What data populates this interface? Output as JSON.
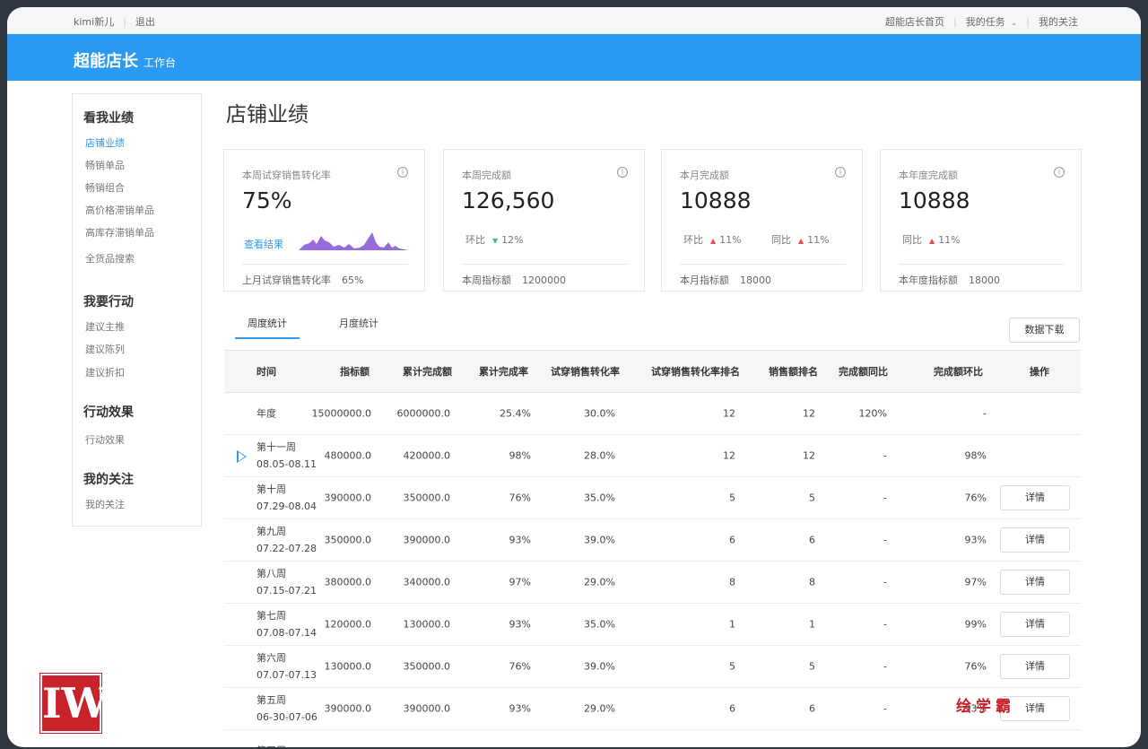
{
  "topbar": {
    "user": "kimi新儿",
    "logout": "退出",
    "home": "超能店长首页",
    "tasks": "我的任务",
    "follow": "我的关注"
  },
  "header": {
    "brand": "超能店长",
    "sub": "工作台"
  },
  "sidebar": {
    "groups": [
      {
        "title": "看我业绩",
        "items": [
          "店铺业绩",
          "畅销单品",
          "畅销组合",
          "高价格滞销单品",
          "高库存滞销单品",
          "全货品搜索"
        ]
      },
      {
        "title": "我要行动",
        "items": [
          "建议主推",
          "建议陈列",
          "建议折扣"
        ]
      },
      {
        "title": "行动效果",
        "items": [
          "行动效果"
        ]
      },
      {
        "title": "我的关注",
        "items": [
          "我的关注"
        ]
      }
    ]
  },
  "page_title": "店铺业绩",
  "cards": [
    {
      "label": "本周试穿销售转化率",
      "value": "75%",
      "link": "查看结果",
      "foot_label": "上月试穿销售转化率",
      "foot_value": "65%"
    },
    {
      "label": "本周完成额",
      "value": "126,560",
      "cmp1_label": "环比",
      "cmp1_value": "12%",
      "cmp1_dir": "down",
      "foot_label": "本周指标额",
      "foot_value": "1200000"
    },
    {
      "label": "本月完成额",
      "value": "10888",
      "cmp1_label": "环比",
      "cmp1_value": "11%",
      "cmp2_label": "同比",
      "cmp2_value": "11%",
      "foot_label": "本月指标额",
      "foot_value": "18000"
    },
    {
      "label": "本年度完成额",
      "value": "10888",
      "cmp1_label": "同比",
      "cmp1_value": "11%",
      "foot_label": "本年度指标额",
      "foot_value": "18000"
    }
  ],
  "info_icon": "i",
  "tabs": [
    "周度统计",
    "月度统计"
  ],
  "download_label": "数据下载",
  "table": {
    "headers": [
      "时间",
      "指标额",
      "累计完成额",
      "累计完成率",
      "试穿销售转化率",
      "试穿销售转化率排名",
      "销售额排名",
      "完成额同比",
      "完成额环比",
      "操作"
    ],
    "detail_label": "详情",
    "rows": [
      {
        "period": "年度",
        "range": "",
        "target": "15000000.0",
        "done": "6000000.0",
        "rate": "25.4%",
        "conv": "30.0%",
        "conv_rank": "12",
        "sales_rank": "12",
        "yoy": "120%",
        "mom": "-"
      },
      {
        "period": "第十一周",
        "range": "08.05-08.11",
        "target": "480000.0",
        "done": "420000.0",
        "rate": "98%",
        "conv": "28.0%",
        "conv_rank": "12",
        "sales_rank": "12",
        "yoy": "-",
        "mom": "98%"
      },
      {
        "period": "第十周",
        "range": "07.29-08.04",
        "target": "390000.0",
        "done": "350000.0",
        "rate": "76%",
        "conv": "35.0%",
        "conv_rank": "5",
        "sales_rank": "5",
        "yoy": "-",
        "mom": "76%"
      },
      {
        "period": "第九周",
        "range": "07.22-07.28",
        "target": "350000.0",
        "done": "390000.0",
        "rate": "93%",
        "conv": "39.0%",
        "conv_rank": "6",
        "sales_rank": "6",
        "yoy": "-",
        "mom": "93%"
      },
      {
        "period": "第八周",
        "range": "07.15-07.21",
        "target": "380000.0",
        "done": "340000.0",
        "rate": "97%",
        "conv": "29.0%",
        "conv_rank": "8",
        "sales_rank": "8",
        "yoy": "-",
        "mom": "97%"
      },
      {
        "period": "第七周",
        "range": "07.08-07.14",
        "target": "120000.0",
        "done": "130000.0",
        "rate": "93%",
        "conv": "35.0%",
        "conv_rank": "1",
        "sales_rank": "1",
        "yoy": "-",
        "mom": "99%"
      },
      {
        "period": "第六周",
        "range": "07.07-07.13",
        "target": "130000.0",
        "done": "350000.0",
        "rate": "76%",
        "conv": "39.0%",
        "conv_rank": "5",
        "sales_rank": "5",
        "yoy": "-",
        "mom": "76%"
      },
      {
        "period": "第五周",
        "range": "06-30-07-06",
        "target": "390000.0",
        "done": "390000.0",
        "rate": "93%",
        "conv": "29.0%",
        "conv_rank": "6",
        "sales_rank": "6",
        "yoy": "-",
        "mom": "93%"
      },
      {
        "period": "第四周",
        "range": "",
        "target": "",
        "done": "",
        "rate": "",
        "conv": "",
        "conv_rank": "",
        "sales_rank": "",
        "yoy": "",
        "mom": ""
      }
    ]
  },
  "watermark": "绘学霸",
  "logo_text": "IW",
  "colors": {
    "accent": "#2b9af3",
    "up": "#e94b4b",
    "down": "#3ec46d",
    "spark": "#8a5cd6",
    "brand_red": "#c8232a"
  }
}
